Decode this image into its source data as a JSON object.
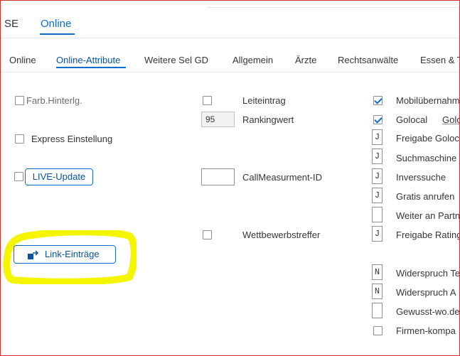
{
  "header": {
    "tabs": [
      {
        "label": "SE",
        "active": false
      },
      {
        "label": "Online",
        "active": true
      }
    ]
  },
  "subtabs": [
    {
      "label": "Online",
      "active": false
    },
    {
      "label": "Online-Attribute",
      "active": true
    },
    {
      "label": "Weitere Sel GD",
      "active": false
    },
    {
      "label": "Allgemein",
      "active": false
    },
    {
      "label": "Ärzte",
      "active": false
    },
    {
      "label": "Rechtsanwälte",
      "active": false
    },
    {
      "label": "Essen & T",
      "active": false
    }
  ],
  "left": {
    "farb_label": "Farb.Hinterlg.",
    "express_label": "Express Einstellung",
    "live_update_label": "LIVE-Update",
    "link_entries_label": "Link-Einträge"
  },
  "middle": {
    "leiteintrag_label": "Leiteintrag",
    "rankingwert_value": "95",
    "rankingwert_label": "Rankingwert",
    "callmeasurment_value": "",
    "callmeasurment_label": "CallMeasurment-ID",
    "wettbewerbstreffer_label": "Wettbewerbstreffer"
  },
  "right": {
    "rows": [
      {
        "kind": "checkbox",
        "checked": true,
        "label": "Mobilübernahm"
      },
      {
        "kind": "checkbox",
        "checked": true,
        "label": "Golocal",
        "extra": "Golo"
      },
      {
        "kind": "field",
        "value": "J",
        "label": "Freigabe Goloc"
      },
      {
        "kind": "field",
        "value": "J",
        "label": "Suchmaschine"
      },
      {
        "kind": "field",
        "value": "J",
        "label": "Inverssuche"
      },
      {
        "kind": "field",
        "value": "J",
        "label": "Gratis anrufen"
      },
      {
        "kind": "field",
        "value": "",
        "label": "Weiter an Partn"
      },
      {
        "kind": "field",
        "value": "J",
        "label": "Freigabe Rating"
      },
      {
        "kind": "field",
        "value": "N",
        "label": "Widerspruch Te"
      },
      {
        "kind": "field",
        "value": "N",
        "label": "Widerspruch A"
      },
      {
        "kind": "field",
        "value": "",
        "label": "Gewusst-wo.de"
      },
      {
        "kind": "checkbox",
        "checked": false,
        "label": "Firmen-kompa"
      }
    ]
  },
  "colors": {
    "accent": "#0a6ed1",
    "highlight": "#f5f500",
    "frame": "#d32f2f"
  }
}
